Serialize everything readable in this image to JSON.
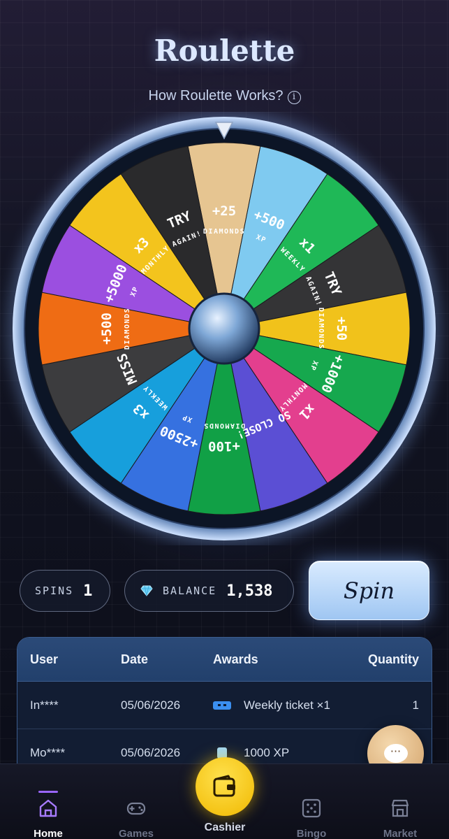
{
  "page": {
    "title": "Roulette",
    "how_link": "How Roulette Works?"
  },
  "wheel": {
    "slices": [
      {
        "main": "+25",
        "sub": "DIAMONDS",
        "color": "#e6c591"
      },
      {
        "main": "+500",
        "sub": "XP",
        "color": "#7fcaf0"
      },
      {
        "main": "x1",
        "sub": "WEEKLY",
        "color": "#1fb857"
      },
      {
        "main": "TRY",
        "sub": "AGAIN!",
        "color": "#343436"
      },
      {
        "main": "+50",
        "sub": "DIAMONDS",
        "color": "#f1c21b"
      },
      {
        "main": "+1000",
        "sub": "XP",
        "color": "#16a84e"
      },
      {
        "main": "x1",
        "sub": "MONTHLY",
        "color": "#e33f8e"
      },
      {
        "main": "SO CLOSE!",
        "sub": "",
        "color": "#5b4fd4"
      },
      {
        "main": "+100",
        "sub": "DIAMONDS",
        "color": "#11a046"
      },
      {
        "main": "+2500",
        "sub": "XP",
        "color": "#3671e0"
      },
      {
        "main": "x3",
        "sub": "WEEKLY",
        "color": "#179fdc"
      },
      {
        "main": "MISS",
        "sub": "",
        "color": "#3c3c3e"
      },
      {
        "main": "+500",
        "sub": "DIAMONDS",
        "color": "#ef6c14"
      },
      {
        "main": "+5000",
        "sub": "XP",
        "color": "#9b4fe0"
      },
      {
        "main": "x3",
        "sub": "MONTHLY",
        "color": "#f3c41d"
      },
      {
        "main": "TRY",
        "sub": "AGAIN!",
        "color": "#2a2a2c"
      }
    ]
  },
  "stats": {
    "spins_label": "SPINS",
    "spins_value": "1",
    "balance_label": "BALANCE",
    "balance_value": "1,538",
    "spin_button": "Spin"
  },
  "table": {
    "headers": {
      "user": "User",
      "date": "Date",
      "awards": "Awards",
      "quantity": "Quantity"
    },
    "rows": [
      {
        "user": "In****",
        "date": "05/06/2026",
        "award": "Weekly ticket ×1",
        "quantity": "1",
        "icon": "ticket-icon"
      },
      {
        "user": "Mo****",
        "date": "05/06/2026",
        "award": "1000 XP",
        "quantity": "",
        "icon": "xp-icon"
      }
    ]
  },
  "chat": {
    "icon": "chat-icon",
    "glyph": "···"
  },
  "nav": {
    "home": "Home",
    "games": "Games",
    "cashier": "Cashier",
    "bingo": "Bingo",
    "market": "Market"
  },
  "colors": {
    "accent": "#9a66ff",
    "cashier": "#f7c700",
    "spin": "#b6d6f7"
  }
}
